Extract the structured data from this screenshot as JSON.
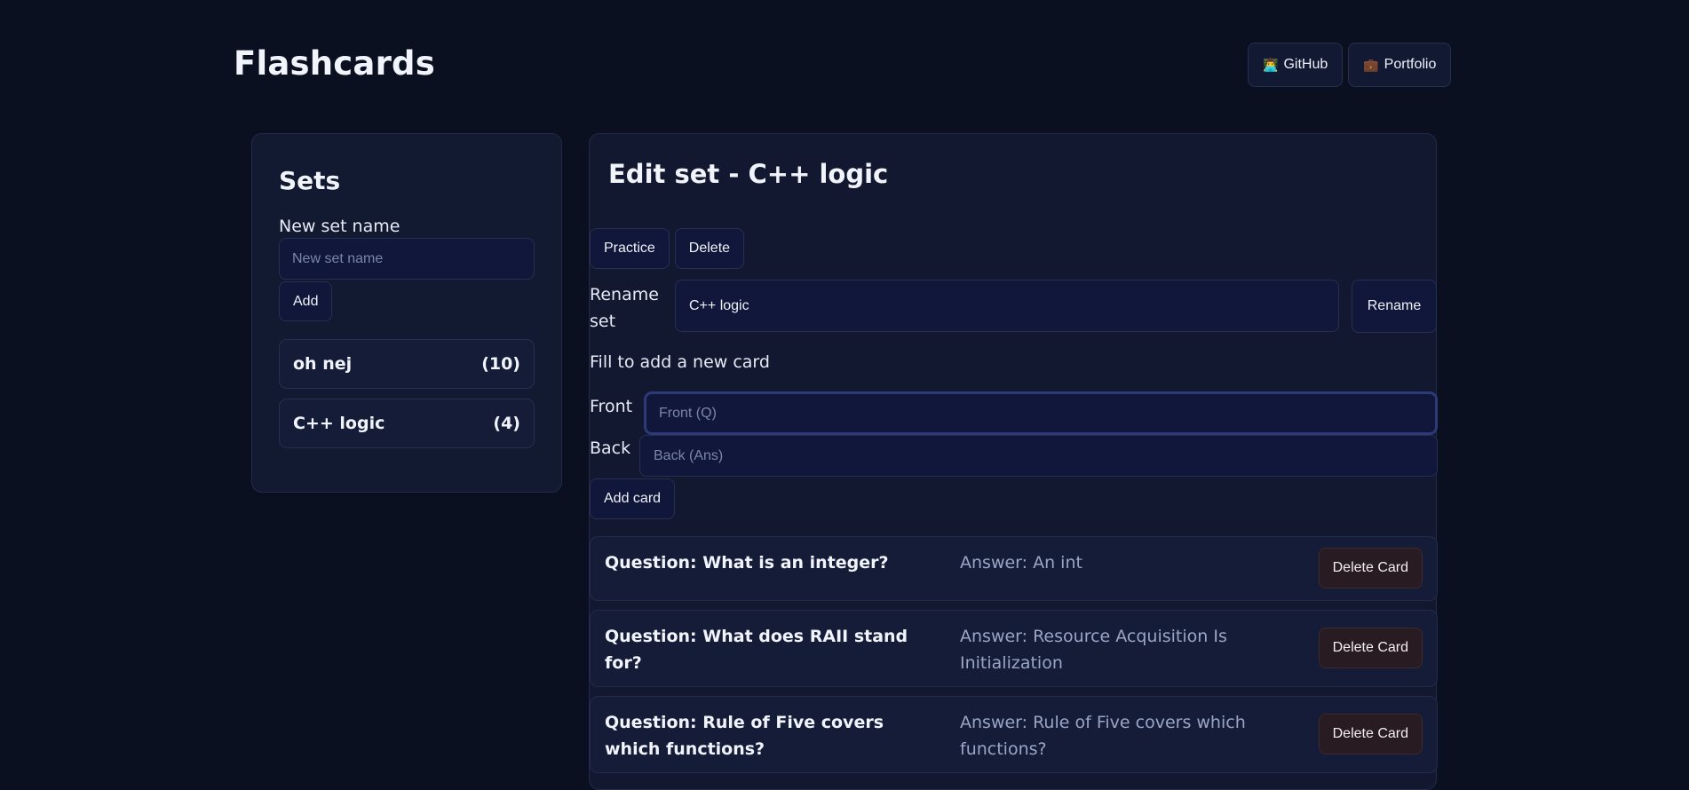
{
  "header": {
    "title": "Flashcards",
    "links": [
      {
        "icon": "👨‍💻",
        "label": "GitHub"
      },
      {
        "icon": "💼",
        "label": "Portfolio"
      }
    ]
  },
  "sets_panel": {
    "title": "Sets",
    "new_set_label": "New set name",
    "new_set_placeholder": "New set name",
    "add_label": "Add",
    "sets": [
      {
        "name": "oh nej",
        "count": "(10)"
      },
      {
        "name": "C++ logic",
        "count": "(4)"
      }
    ]
  },
  "edit_panel": {
    "title": "Edit set - C++ logic",
    "practice_label": "Practice",
    "delete_label": "Delete",
    "rename_label": "Rename set",
    "rename_value": "C++ logic",
    "rename_button": "Rename",
    "hint": "Fill to add a new card",
    "front_label": "Front",
    "front_placeholder": "Front (Q)",
    "back_label": "Back",
    "back_placeholder": "Back (Ans)",
    "add_card_label": "Add card",
    "delete_card_label": "Delete Card",
    "cards": [
      {
        "question": "Question: What is an integer?",
        "answer": "Answer: An int"
      },
      {
        "question": "Question: What does RAII stand for?",
        "answer": "Answer: Resource Acquisition Is Initialization"
      },
      {
        "question": "Question: Rule of Five covers which functions?",
        "answer": "Answer: Rule of Five covers which functions?"
      }
    ]
  }
}
